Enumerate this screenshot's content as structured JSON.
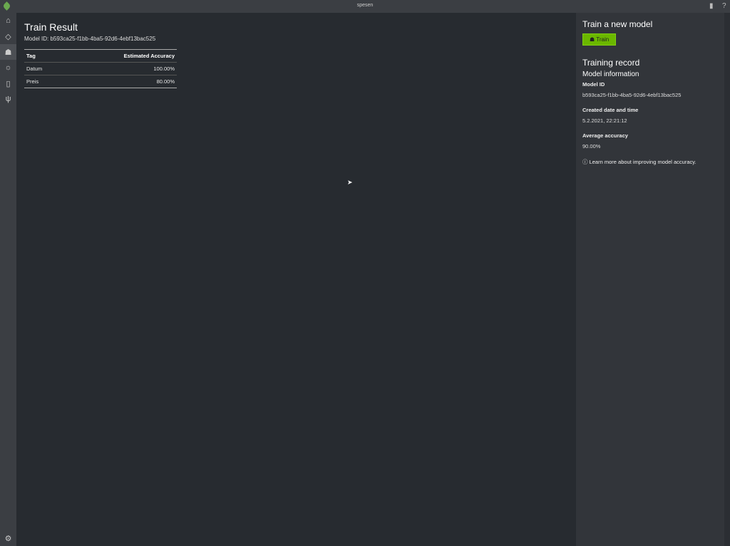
{
  "window": {
    "title": "spesen"
  },
  "nav": [
    {
      "name": "home-icon",
      "glyph": "⌂"
    },
    {
      "name": "tag-icon",
      "glyph": "◇"
    },
    {
      "name": "train-icon",
      "glyph": "☗"
    },
    {
      "name": "lightbulb-icon",
      "glyph": "☼"
    },
    {
      "name": "document-icon",
      "glyph": "▯"
    },
    {
      "name": "plug-icon",
      "glyph": "ψ"
    }
  ],
  "settings_glyph": "⚙",
  "main": {
    "title": "Train Result",
    "model_id": "Model ID: b593ca25-f1bb-4ba5-92d6-4ebf13bac525",
    "table": {
      "headers": [
        "Tag",
        "Estimated Accuracy"
      ],
      "rows": [
        [
          "Datum",
          "100.00%"
        ],
        [
          "Preis",
          "80.00%"
        ]
      ]
    }
  },
  "panel": {
    "train_title": "Train a new model",
    "train_button": "Train",
    "record_title": "Training record",
    "info_title": "Model information",
    "model_id_label": "Model ID",
    "model_id": "b593ca25-f1bb-4ba5-92d6-4ebf13bac525",
    "created_label": "Created date and time",
    "created": "5.2.2021, 22:21:12",
    "avg_label": "Average accuracy",
    "avg": "90.00%",
    "learn_more": "Learn more about improving model accuracy."
  }
}
